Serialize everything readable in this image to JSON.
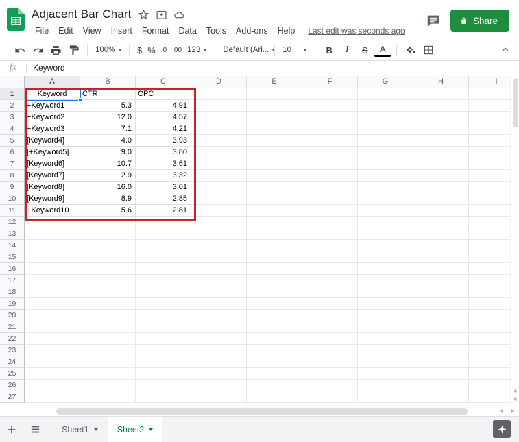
{
  "app": {
    "logo_icon": "google-sheets-icon",
    "doc_title": "Adjacent Bar Chart",
    "title_icons": [
      "star-icon",
      "move-to-folder-icon",
      "cloud-saved-icon"
    ],
    "menus": [
      "File",
      "Edit",
      "View",
      "Insert",
      "Format",
      "Data",
      "Tools",
      "Add-ons",
      "Help"
    ],
    "last_edit": "Last edit was seconds ago",
    "comment_icon": "comment-icon",
    "share_label": "Share",
    "share_icon": "lock-icon"
  },
  "toolbar": {
    "undo_icon": "undo-icon",
    "redo_icon": "redo-icon",
    "print_icon": "print-icon",
    "paint_icon": "paint-format-icon",
    "zoom_value": "100%",
    "currency_label": "$",
    "percent_label": "%",
    "decimal_dec_label": ".0",
    "decimal_inc_label": ".00",
    "number_format_label": "123",
    "font_value": "Default (Ari...",
    "font_size_value": "10",
    "bold_label": "B",
    "italic_label": "I",
    "strikethrough_label": "S",
    "text_color_label": "A",
    "fill_color_icon": "fill-color-icon",
    "borders_icon": "borders-icon",
    "collapse_icon": "chevron-up-icon"
  },
  "formula_bar": {
    "fx_label": "fx",
    "value": "Keyword",
    "placeholder": ""
  },
  "grid": {
    "columns": [
      "A",
      "B",
      "C",
      "D",
      "E",
      "F",
      "G",
      "H",
      "I"
    ],
    "selected_column": "A",
    "selected_row": "1",
    "rows": [
      {
        "n": "1",
        "cells": [
          "Keyword",
          "CTR",
          "CPC"
        ]
      },
      {
        "n": "2",
        "cells": [
          "+Keyword1",
          "5.3",
          "4.91"
        ]
      },
      {
        "n": "3",
        "cells": [
          "+Keyword2",
          "12.0",
          "4.57"
        ]
      },
      {
        "n": "4",
        "cells": [
          "+Keyword3",
          "7.1",
          "4.21"
        ]
      },
      {
        "n": "5",
        "cells": [
          "[Keyword4]",
          "4.0",
          "3.93"
        ]
      },
      {
        "n": "6",
        "cells": [
          "[+Keyword5]",
          "9.0",
          "3.80"
        ]
      },
      {
        "n": "7",
        "cells": [
          "[Keyword6]",
          "10.7",
          "3.61"
        ]
      },
      {
        "n": "8",
        "cells": [
          "[Keyword7]",
          "2.9",
          "3.32"
        ]
      },
      {
        "n": "9",
        "cells": [
          "[Keyword8]",
          "16.0",
          "3.01"
        ]
      },
      {
        "n": "10",
        "cells": [
          "[Keyword9]",
          "8.9",
          "2.85"
        ]
      },
      {
        "n": "11",
        "cells": [
          "+Keyword10",
          "5.6",
          "2.81"
        ]
      },
      {
        "n": "12",
        "cells": [
          "",
          "",
          ""
        ]
      },
      {
        "n": "13",
        "cells": [
          "",
          "",
          ""
        ]
      },
      {
        "n": "14",
        "cells": [
          "",
          "",
          ""
        ]
      },
      {
        "n": "15",
        "cells": [
          "",
          "",
          ""
        ]
      },
      {
        "n": "16",
        "cells": [
          "",
          "",
          ""
        ]
      },
      {
        "n": "17",
        "cells": [
          "",
          "",
          ""
        ]
      },
      {
        "n": "18",
        "cells": [
          "",
          "",
          ""
        ]
      },
      {
        "n": "19",
        "cells": [
          "",
          "",
          ""
        ]
      },
      {
        "n": "20",
        "cells": [
          "",
          "",
          ""
        ]
      },
      {
        "n": "21",
        "cells": [
          "",
          "",
          ""
        ]
      },
      {
        "n": "22",
        "cells": [
          "",
          "",
          ""
        ]
      },
      {
        "n": "23",
        "cells": [
          "",
          "",
          ""
        ]
      },
      {
        "n": "24",
        "cells": [
          "",
          "",
          ""
        ]
      },
      {
        "n": "25",
        "cells": [
          "",
          "",
          ""
        ]
      },
      {
        "n": "26",
        "cells": [
          "",
          "",
          ""
        ]
      },
      {
        "n": "27",
        "cells": [
          "",
          "",
          ""
        ]
      }
    ],
    "annotation_color": "#cc2127"
  },
  "sheetbar": {
    "add_sheet_icon": "plus-icon",
    "all_sheets_icon": "list-icon",
    "tabs": [
      {
        "label": "Sheet1",
        "active": false
      },
      {
        "label": "Sheet2",
        "active": true
      }
    ],
    "explore_icon": "explore-icon"
  },
  "colors": {
    "brand_green": "#0f9d58",
    "share_green": "#1e8e3e",
    "accent_blue": "#1a73e8",
    "annotation_red": "#cc2127"
  }
}
